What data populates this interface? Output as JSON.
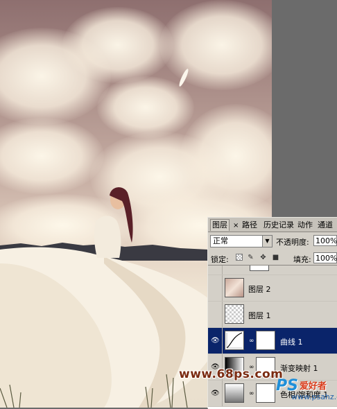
{
  "tabs": {
    "layers": "图层",
    "close": "×",
    "paths": "路径",
    "history": "历史记录",
    "actions": "动作",
    "channels": "通道"
  },
  "blend": {
    "mode": "正常",
    "opacity_label": "不透明度:",
    "opacity_value": "100%"
  },
  "lock": {
    "label": "锁定:",
    "fill_label": "填充:",
    "fill_value": "100%"
  },
  "layers": [
    {
      "name": "",
      "visible": false,
      "selected": false
    },
    {
      "name": "图层 2",
      "visible": false,
      "selected": false
    },
    {
      "name": "图层 1",
      "visible": false,
      "selected": false
    },
    {
      "name": "曲线 1",
      "visible": true,
      "selected": true
    },
    {
      "name": "渐变映射 1",
      "visible": true,
      "selected": false
    },
    {
      "name": "色相/饱和度 1",
      "visible": true,
      "selected": false
    }
  ],
  "watermark": {
    "left_text": "www.68ps.com",
    "logo_ps": "PS",
    "logo_cn": "爱好者",
    "logo_url": "www.psahz.com"
  },
  "colors": {
    "selection": "#0a246a",
    "panel_bg": "#d4d0c8"
  }
}
